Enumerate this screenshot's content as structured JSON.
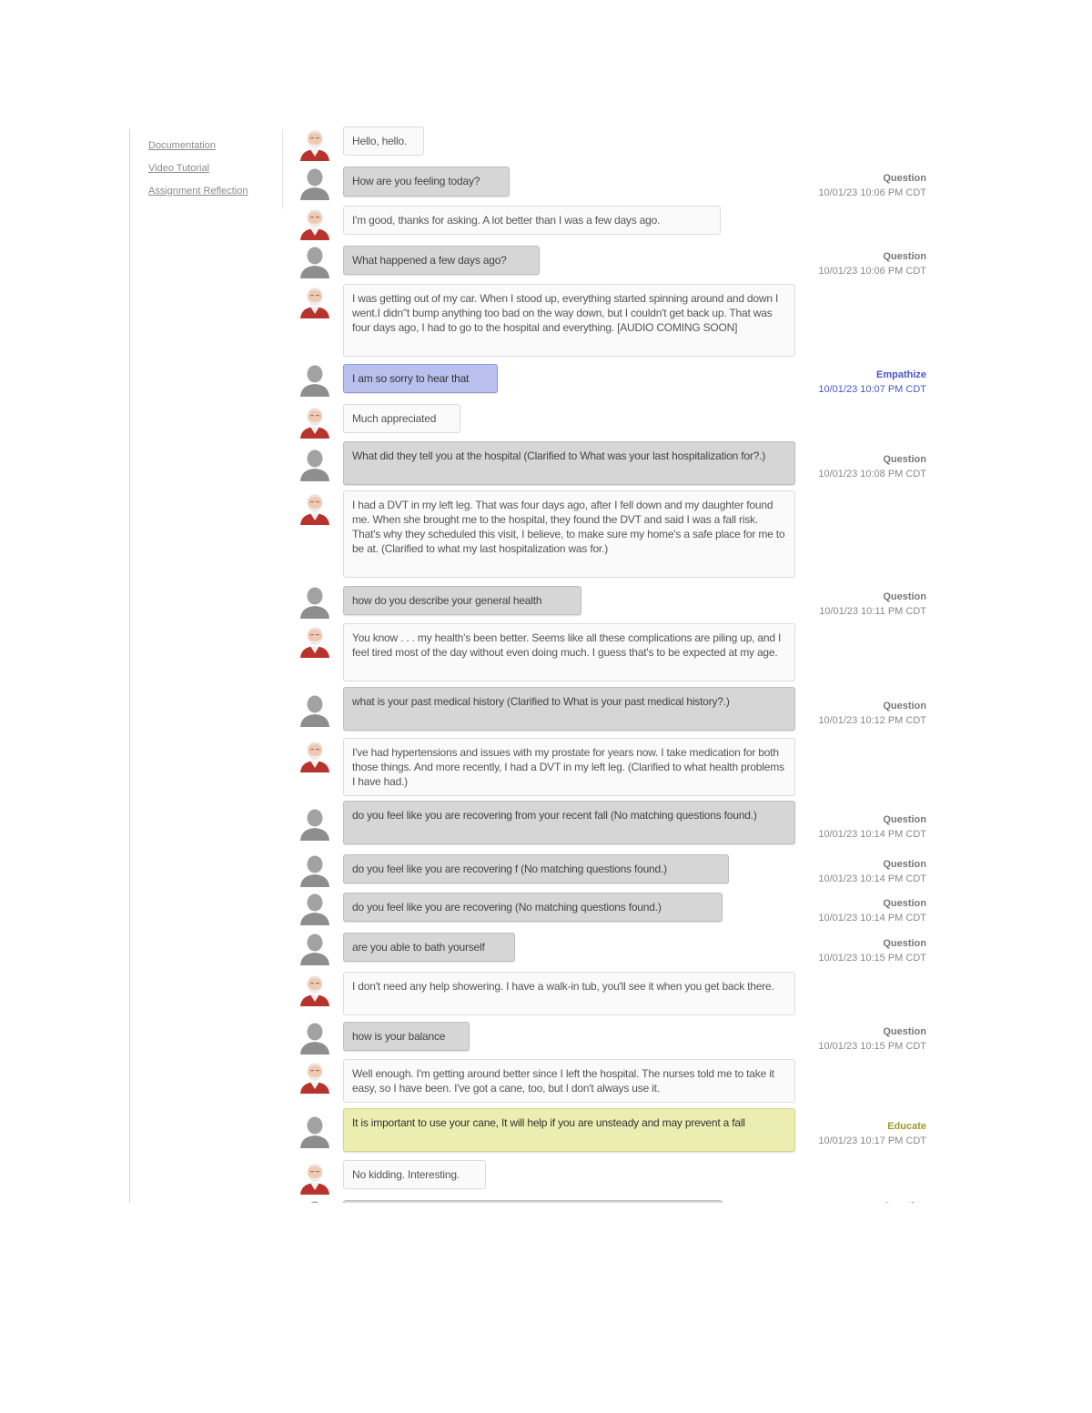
{
  "nav": {
    "links": [
      "Documentation",
      "Video Tutorial",
      "Assignment Reflection"
    ]
  },
  "colors": {
    "patient_bubble": "#fafafa",
    "student_bubble": "#d6d6d6",
    "empathize_bubble": "#b9c0ee",
    "educate_bubble": "#ecedb0",
    "empathize_accent": "#4a55c8"
  },
  "messages": [
    {
      "speaker": "patient",
      "text": "Hello, hello."
    },
    {
      "speaker": "student",
      "text": "How are you feeling today?",
      "type": "Question",
      "time": "10/01/23 10:06 PM CDT"
    },
    {
      "speaker": "patient",
      "text": "I'm good, thanks for asking. A lot better than I was a few days ago."
    },
    {
      "speaker": "student",
      "text": "What happened a few days ago?",
      "type": "Question",
      "time": "10/01/23 10:06 PM CDT"
    },
    {
      "speaker": "patient",
      "text": "I was getting out of my car. When I stood up, everything started spinning around and down I went.I didn\"t bump anything too bad on the way down, but I couldn't get back up. That was four days ago, I had to go to the hospital and everything. [AUDIO COMING SOON]"
    },
    {
      "speaker": "student",
      "style": "empathize",
      "text": "I am so sorry to hear that",
      "type": "Empathize",
      "time": "10/01/23 10:07 PM CDT"
    },
    {
      "speaker": "patient",
      "text": "Much appreciated"
    },
    {
      "speaker": "student",
      "text": "What did they tell you at the hospital (Clarified to What was your last hospitalization for?.)",
      "type": "Question",
      "time": "10/01/23 10:08 PM CDT"
    },
    {
      "speaker": "patient",
      "text": "I had a DVT in my left leg. That was four days ago, after I fell down and my daughter found me. When she brought me to the hospital, they found the DVT and said I was a fall risk. That's why they scheduled this visit, I believe, to make sure my home's a safe place for me to be at. (Clarified to what my last hospitalization was for.)"
    },
    {
      "speaker": "student",
      "text": "how do you describe your general health",
      "type": "Question",
      "time": "10/01/23 10:11 PM CDT"
    },
    {
      "speaker": "patient",
      "text": "You know . . . my health's been better. Seems like all these complications are piling up, and I feel tired most of the day without even doing much. I guess that's to be expected at my age."
    },
    {
      "speaker": "student",
      "text": "what is your past medical history (Clarified to What is your past medical history?.)",
      "type": "Question",
      "time": "10/01/23 10:12 PM CDT"
    },
    {
      "speaker": "patient",
      "text": "I've had hypertensions and issues with my prostate for years now. I take medication for both those things. And more recently, I had a DVT in my left leg. (Clarified to what health problems I have had.)"
    },
    {
      "speaker": "student",
      "text": "do you feel like you are recovering from your recent fall (No matching questions found.)",
      "type": "Question",
      "time": "10/01/23 10:14 PM CDT"
    },
    {
      "speaker": "student",
      "text": "do you feel like you are recovering f (No matching questions found.)",
      "type": "Question",
      "time": "10/01/23 10:14 PM CDT"
    },
    {
      "speaker": "student",
      "text": "do you feel like you are recovering (No matching questions found.)",
      "type": "Question",
      "time": "10/01/23 10:14 PM CDT"
    },
    {
      "speaker": "student",
      "text": "are you able to bath yourself",
      "type": "Question",
      "time": "10/01/23 10:15 PM CDT"
    },
    {
      "speaker": "patient",
      "text": "I don't need any help showering. I have a walk-in tub, you'll see it when you get back there."
    },
    {
      "speaker": "student",
      "text": "how is your balance",
      "type": "Question",
      "time": "10/01/23 10:15 PM CDT"
    },
    {
      "speaker": "patient",
      "text": "Well enough. I'm getting around better since I left the hospital. The nurses told me to take it easy, so I have been. I've got a cane, too, but I don't always use it."
    },
    {
      "speaker": "student",
      "style": "educate",
      "text": "It is important to use your cane, It will help if you are unsteady and may prevent a fall",
      "type": "Educate",
      "time": "10/01/23 10:17 PM CDT"
    },
    {
      "speaker": "patient",
      "text": "No kidding. Interesting."
    },
    {
      "speaker": "student",
      "text": "",
      "type": "Question",
      "time": ""
    }
  ]
}
